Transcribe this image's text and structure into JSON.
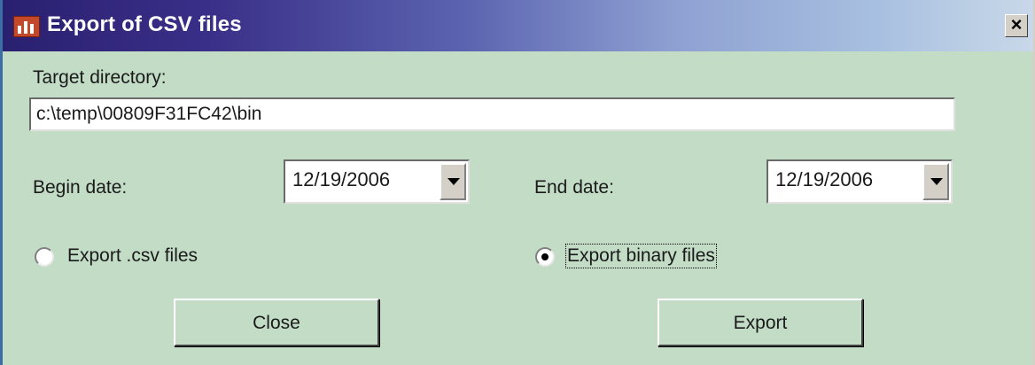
{
  "window": {
    "title": "Export of CSV files",
    "close_glyph": "×"
  },
  "form": {
    "target_directory_label": "Target directory:",
    "target_directory_value": "c:\\temp\\00809F31FC42\\bin",
    "begin_date_label": "Begin date:",
    "begin_date_value": "12/19/2006",
    "end_date_label": "End date:",
    "end_date_value": "12/19/2006",
    "radio_csv_label": "Export .csv files",
    "radio_csv_selected": false,
    "radio_binary_label": "Export binary files",
    "radio_binary_selected": true
  },
  "buttons": {
    "close_label": "Close",
    "export_label": "Export"
  },
  "colors": {
    "dialog_background": "#c2dcc6",
    "title_gradient_start": "#2a2070",
    "title_gradient_end": "#c8d8e8"
  },
  "icons": [
    "app-chart-icon",
    "close-icon",
    "dropdown-arrow-icon"
  ]
}
